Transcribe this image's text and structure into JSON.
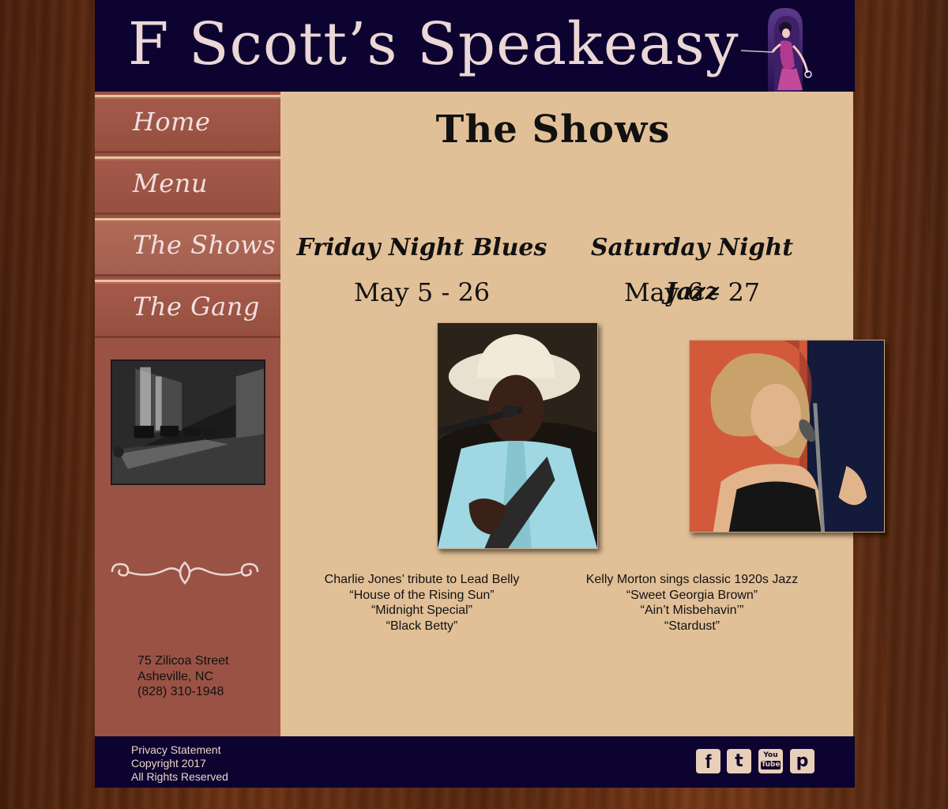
{
  "header": {
    "site_title": "F Scott’s Speakeasy"
  },
  "nav": {
    "items": [
      {
        "label": "Home"
      },
      {
        "label": "Menu"
      },
      {
        "label": "The Shows",
        "active": true
      },
      {
        "label": "The Gang"
      }
    ]
  },
  "address": {
    "street": "75 Zilicoa Street",
    "city": "Asheville, NC",
    "phone": "(828) 310-1948"
  },
  "main": {
    "title": "The Shows",
    "shows": [
      {
        "name": "Friday Night Blues",
        "dates": "May 5 - 26",
        "lines": [
          "Charlie Jones’ tribute to Lead Belly",
          "“House of the Rising Sun”",
          "“Midnight Special”",
          "“Black Betty”"
        ]
      },
      {
        "name": "Saturday Night Jazz",
        "dates": "May 6 - 27",
        "lines": [
          "Kelly Morton sings classic 1920s Jazz",
          "“Sweet Georgia Brown”",
          "“Ain’t Misbehavin’”",
          "“Stardust”"
        ]
      }
    ]
  },
  "footer": {
    "privacy": "Privacy Statement",
    "copyright": "Copyright 2017",
    "rights": "All Rights Reserved",
    "social": [
      {
        "icon": "facebook-icon",
        "glyph": "f"
      },
      {
        "icon": "twitter-icon",
        "glyph": "t"
      },
      {
        "icon": "youtube-icon",
        "glyph_top": "You",
        "glyph_bottom": "Tube"
      },
      {
        "icon": "pinterest-icon",
        "glyph": "p"
      }
    ]
  },
  "colors": {
    "header_bg": "#0d0330",
    "sidebar_bg": "#9a5245",
    "main_bg": "#e2c097",
    "title_text": "#ead7d6"
  }
}
